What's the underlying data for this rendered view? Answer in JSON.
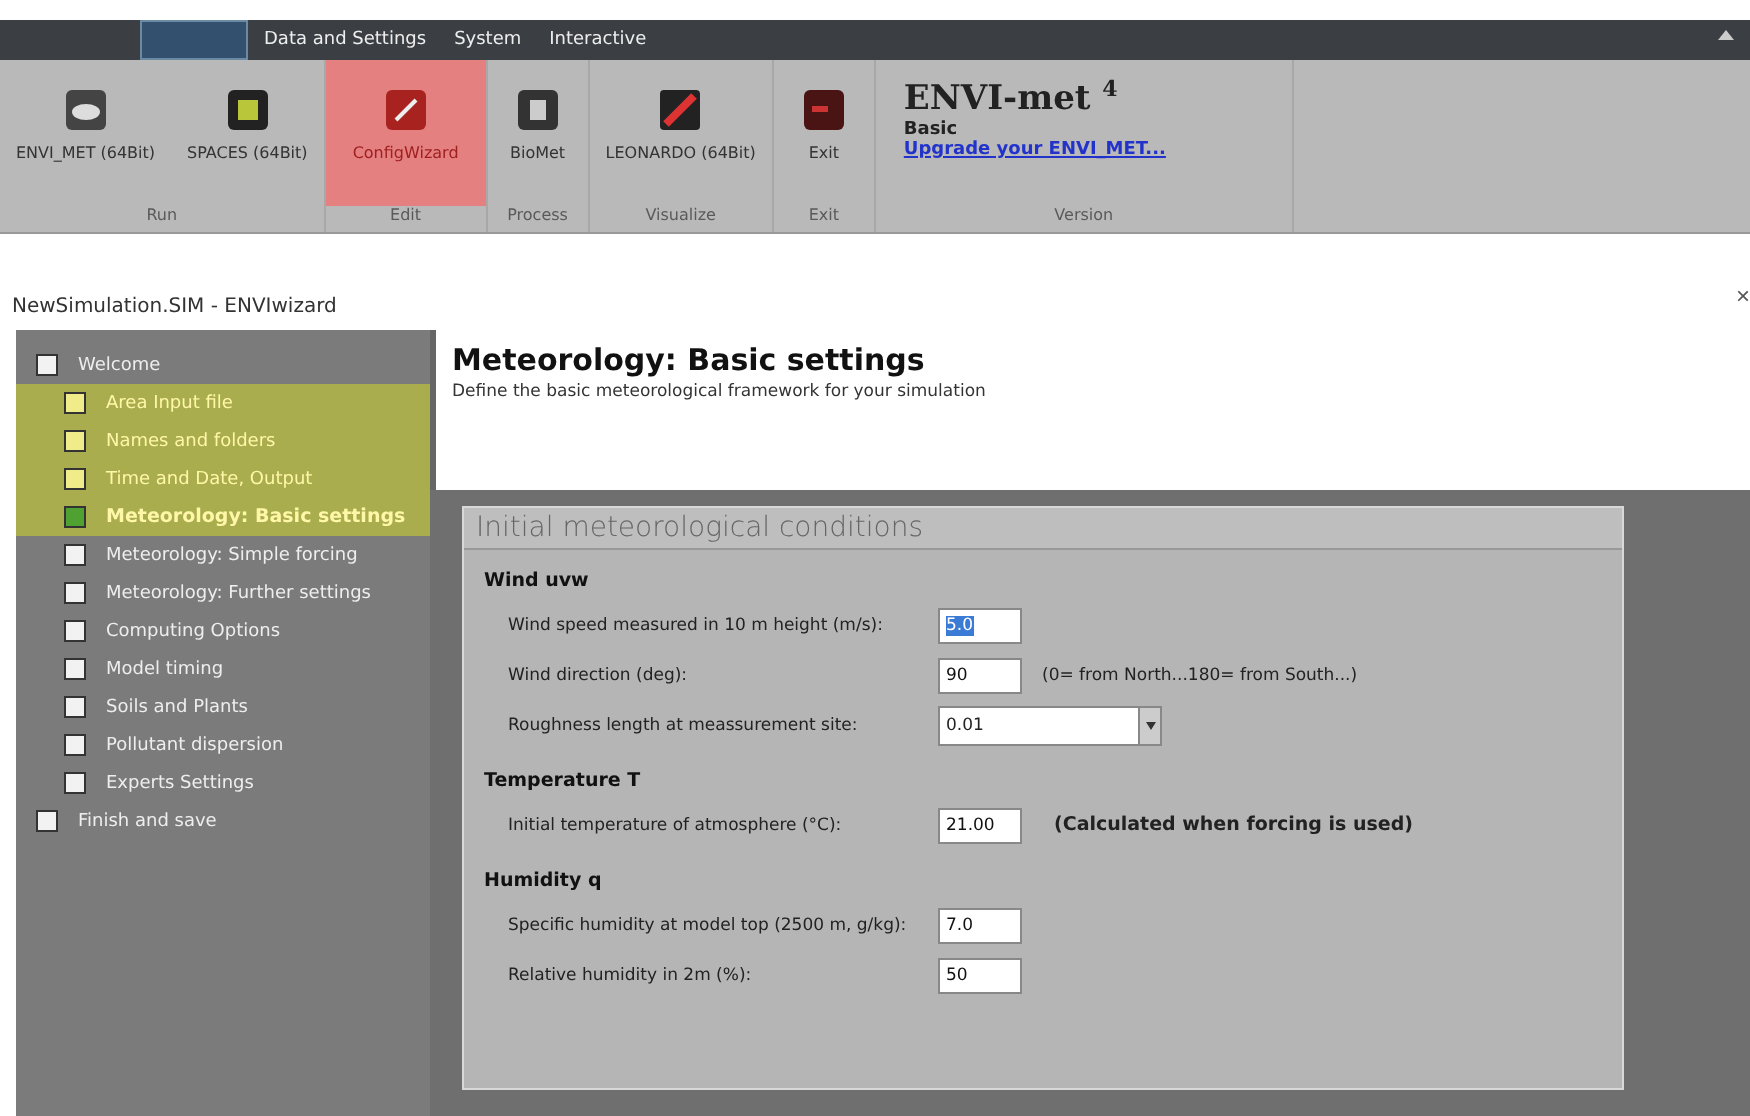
{
  "ribbon": {
    "tabs": [
      {
        "selected": true
      },
      {
        "label": "Data and Settings",
        "selected": false
      },
      {
        "label": "System",
        "selected": false
      },
      {
        "label": "Interactive",
        "selected": false
      }
    ],
    "groups": [
      {
        "label": "Run",
        "buttons": [
          {
            "label": "ENVI_MET (64Bit)",
            "selected": false
          },
          {
            "label": "SPACES (64Bit)",
            "selected": false
          }
        ]
      },
      {
        "label": "Edit",
        "buttons": [
          {
            "label": "ConfigWizard",
            "selected": true
          }
        ]
      },
      {
        "label": "Process",
        "buttons": [
          {
            "label": "BioMet",
            "selected": false
          }
        ]
      },
      {
        "label": "Visualize",
        "buttons": [
          {
            "label": "LEONARDO (64Bit)",
            "selected": false
          }
        ]
      },
      {
        "label": "Exit",
        "buttons": [
          {
            "label": "Exit",
            "selected": false
          }
        ]
      }
    ],
    "version": {
      "product": "ENVI-met",
      "major": "4",
      "edition": "Basic",
      "link": "Upgrade your ENVI_MET...",
      "label": "Version"
    }
  },
  "window": {
    "title": "NewSimulation.SIM - ENVIwizard",
    "close": "×"
  },
  "steps": [
    {
      "label": "Welcome",
      "kind": "pending",
      "children": [
        {
          "label": "Area Input file",
          "kind": "done"
        },
        {
          "label": "Names and folders",
          "kind": "done"
        },
        {
          "label": "Time and Date, Output",
          "kind": "done"
        },
        {
          "label": "Meteorology: Basic settings",
          "kind": "current"
        },
        {
          "label": "Meteorology: Simple forcing",
          "kind": "pending"
        },
        {
          "label": "Meteorology: Further settings",
          "kind": "pending"
        },
        {
          "label": "Computing Options",
          "kind": "pending"
        },
        {
          "label": "Model timing",
          "kind": "pending"
        },
        {
          "label": "Soils and Plants",
          "kind": "pending"
        },
        {
          "label": "Pollutant dispersion",
          "kind": "pending"
        },
        {
          "label": "Experts Settings",
          "kind": "pending"
        }
      ]
    },
    {
      "label": "Finish and save",
      "kind": "pending"
    }
  ],
  "page": {
    "title": "Meteorology: Basic settings",
    "subtitle": "Define the basic meteorological framework for your simulation"
  },
  "panel": {
    "title": "Initial meteorological conditions",
    "sections": [
      {
        "title": "Wind uvw",
        "rows": [
          {
            "kind": "field",
            "label": "Wind speed measured in 10 m height (m/s):",
            "value": "5.0",
            "selected": true
          },
          {
            "kind": "field",
            "label": "Wind direction (deg):",
            "value": "90",
            "selected": false,
            "note": "(0= from North...180= from South...)",
            "note_bold": false
          },
          {
            "kind": "dropdown",
            "label": "Roughness length at meassurement site:",
            "value": "0.01"
          }
        ]
      },
      {
        "title": "Temperature T",
        "rows": [
          {
            "kind": "field",
            "label": "Initial temperature of atmosphere (°C):",
            "value": "21.00",
            "selected": false,
            "note": "(Calculated when forcing is used)",
            "note_bold": true
          }
        ]
      },
      {
        "title": "Humidity q",
        "rows": [
          {
            "kind": "field",
            "label": "Specific humidity at model top (2500 m, g/kg):",
            "value": "7.0",
            "selected": false
          },
          {
            "kind": "field",
            "label": "Relative humidity in 2m (%):",
            "value": "50",
            "selected": false
          }
        ]
      }
    ]
  }
}
